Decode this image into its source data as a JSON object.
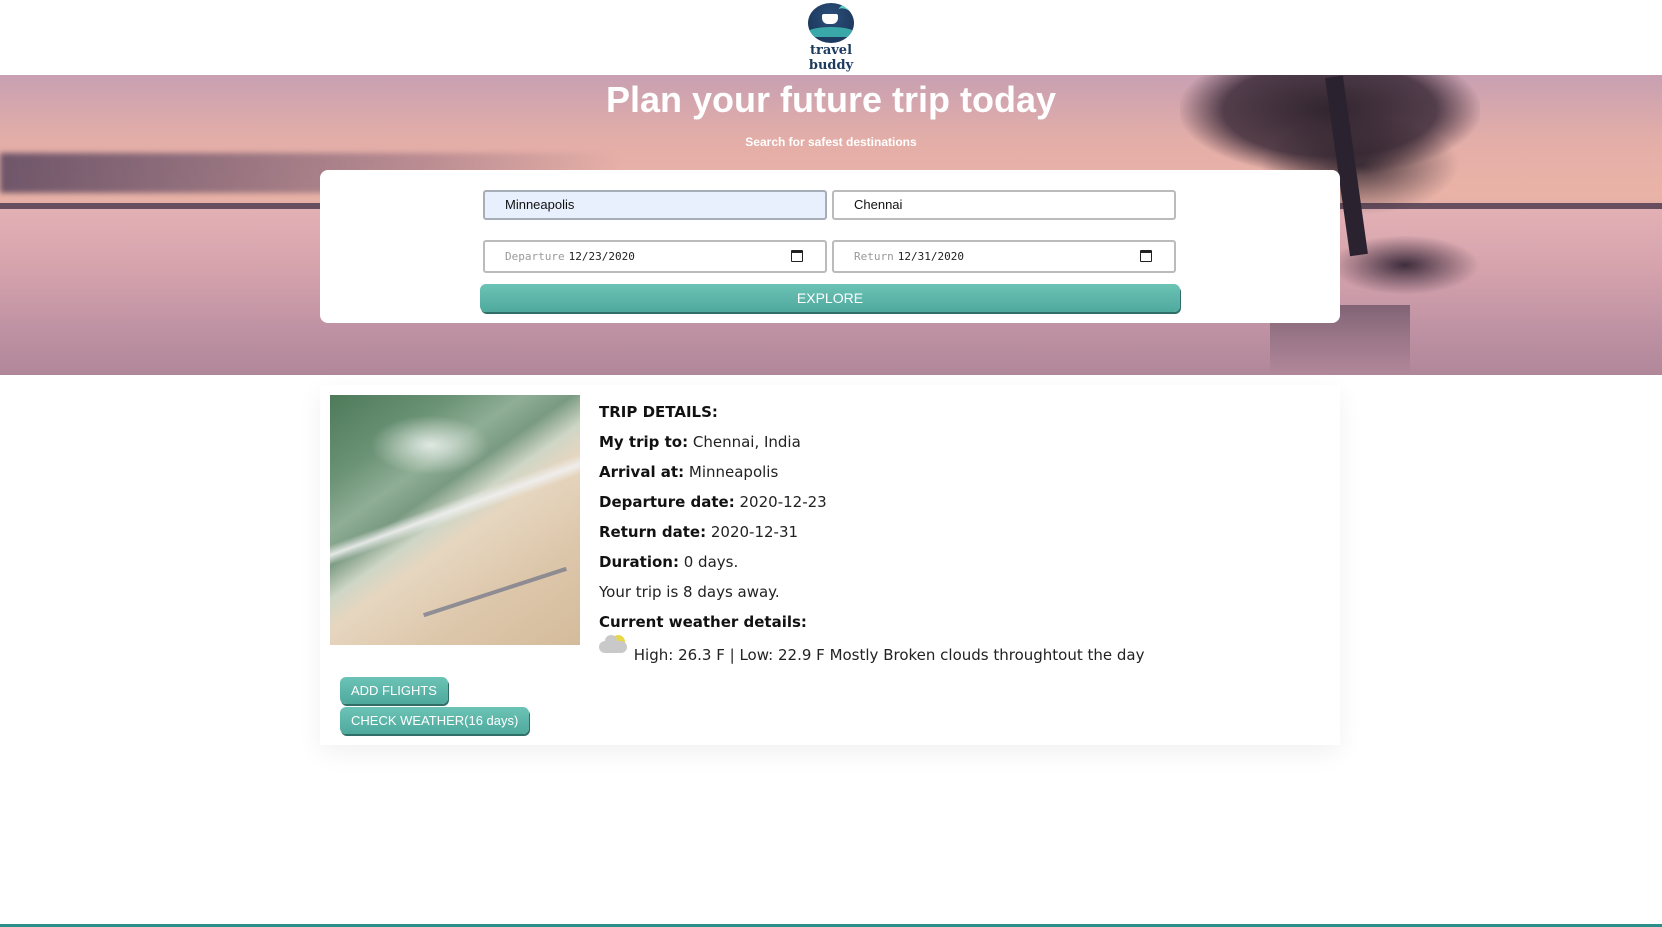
{
  "brand": {
    "logo_text": "travel buddy"
  },
  "hero": {
    "title": "Plan your future trip today",
    "subtitle": "Search for safest destinations"
  },
  "search": {
    "from_value": "Minneapolis",
    "to_value": "Chennai",
    "departure_placeholder": "Departure",
    "departure_value": "12/23/2020",
    "return_placeholder": "Return",
    "return_value": "12/31/2020",
    "explore_label": "EXPLORE"
  },
  "trip": {
    "heading": "TRIP DETAILS:",
    "destination_label": "My trip to:",
    "destination_value": "Chennai, India",
    "arrival_label": "Arrival at:",
    "arrival_value": "Minneapolis",
    "departure_label": "Departure date:",
    "departure_value": "2020-12-23",
    "return_label": "Return date:",
    "return_value": "2020-12-31",
    "duration_label": "Duration:",
    "duration_value": "0 days.",
    "countdown": "Your trip is 8 days away.",
    "weather_heading": "Current weather details:",
    "weather_text": "High: 26.3 F | Low: 22.9 F Mostly Broken clouds throughtout the day",
    "weather_icon": "partly-cloudy-icon"
  },
  "actions": {
    "add_flights": "ADD FLIGHTS",
    "check_weather": "CHECK WEATHER(16 days)"
  },
  "colors": {
    "accent": "#56b0a4",
    "footer_line": "#2b8f89"
  }
}
